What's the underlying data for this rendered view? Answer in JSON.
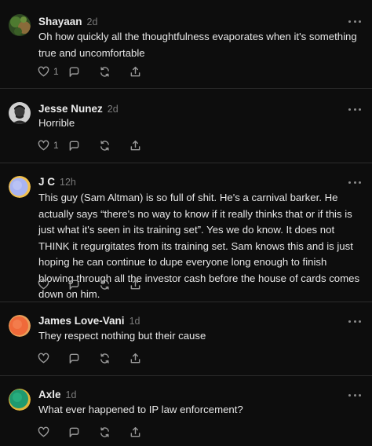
{
  "comments": [
    {
      "author": "Shayaan",
      "time": "2d",
      "text": "Oh how quickly all the thoughtfulness evaporates when it's something true and uncomfortable",
      "likes": "1",
      "avatar_colors": [
        "#3c5a2a",
        "#8a6b3a"
      ]
    },
    {
      "author": "Jesse Nunez",
      "time": "2d",
      "text": "Horrible",
      "likes": "1",
      "avatar_colors": [
        "#d0d0d0",
        "#2a2a2a"
      ]
    },
    {
      "author": "J C",
      "time": "12h",
      "text": "This guy (Sam Altman) is so full of shit. He's a carnival barker. He actually says “there's no way to know if it really thinks that or if this is just what it's seen in its training set”. Yes we do know. It does not THINK it regurgitates from its training set. Sam knows this and is just hoping he can continue to dupe everyone long enough to finish blowing through all the investor cash before the house of cards comes down on him.",
      "likes": "",
      "avatar_colors": [
        "#a9b4f2",
        "#f2c14e"
      ]
    },
    {
      "author": "James Love-Vani",
      "time": "1d",
      "text": "They respect nothing but their cause",
      "likes": "",
      "avatar_colors": [
        "#f06a3a",
        "#e8a05a"
      ]
    },
    {
      "author": "Axle",
      "time": "1d",
      "text": "What ever happened to IP law enforcement?",
      "likes": "",
      "avatar_colors": [
        "#1f9a6f",
        "#e0b53a"
      ]
    }
  ],
  "icons": [
    "heart-icon",
    "comment-icon",
    "restack-icon",
    "share-icon",
    "more-icon"
  ]
}
